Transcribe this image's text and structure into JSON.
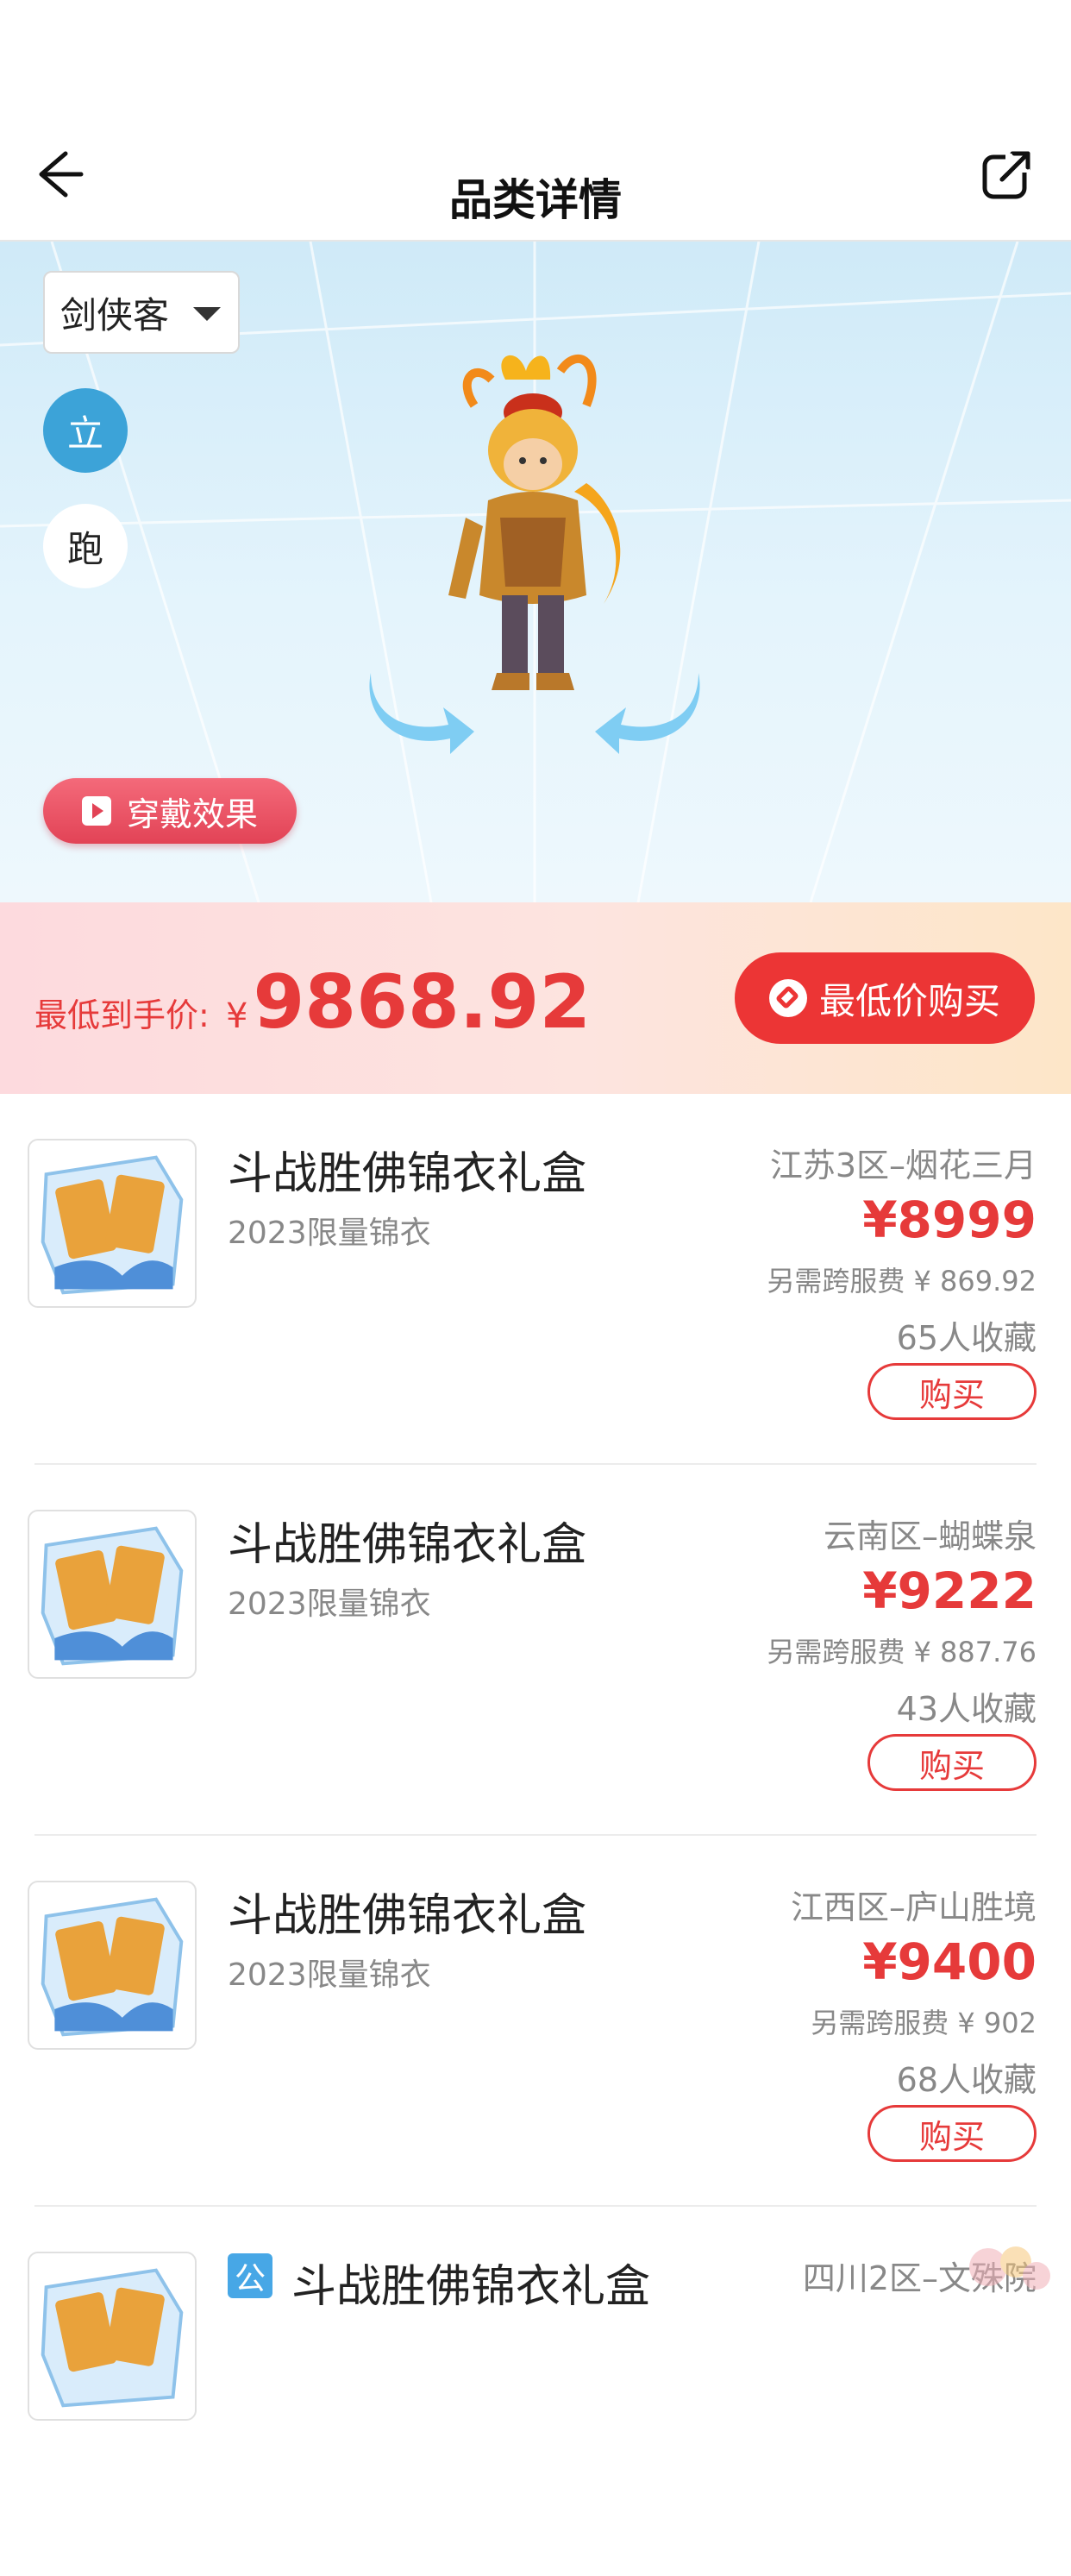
{
  "nav": {
    "title": "品类详情"
  },
  "hero": {
    "role_selected": "剑侠客",
    "pose_stand": "立",
    "pose_run": "跑",
    "wear_effect_label": "穿戴效果"
  },
  "price_bar": {
    "label": "最低到手价:",
    "currency": "¥",
    "amount": "9868.92",
    "buy_label": "最低价购买"
  },
  "items": [
    {
      "name": "斗战胜佛锦衣礼盒",
      "sub": "2023限量锦衣",
      "server": "江苏3区–烟花三月",
      "price": "¥8999",
      "fee": "另需跨服费 ¥ 869.92",
      "favs": "65人收藏",
      "buy": "购买"
    },
    {
      "name": "斗战胜佛锦衣礼盒",
      "sub": "2023限量锦衣",
      "server": "云南区–蝴蝶泉",
      "price": "¥9222",
      "fee": "另需跨服费 ¥ 887.76",
      "favs": "43人收藏",
      "buy": "购买"
    },
    {
      "name": "斗战胜佛锦衣礼盒",
      "sub": "2023限量锦衣",
      "server": "江西区–庐山胜境",
      "price": "¥9400",
      "fee": "另需跨服费 ¥ 902",
      "favs": "68人收藏",
      "buy": "购买"
    },
    {
      "badge": "公",
      "name": "斗战胜佛锦衣礼盒",
      "sub": "",
      "server": "四川2区–文殊院",
      "price": "",
      "fee": "",
      "favs": "",
      "buy": ""
    }
  ],
  "colors": {
    "accent_red": "#e63a3a",
    "stand_blue": "#3ca3d8"
  }
}
